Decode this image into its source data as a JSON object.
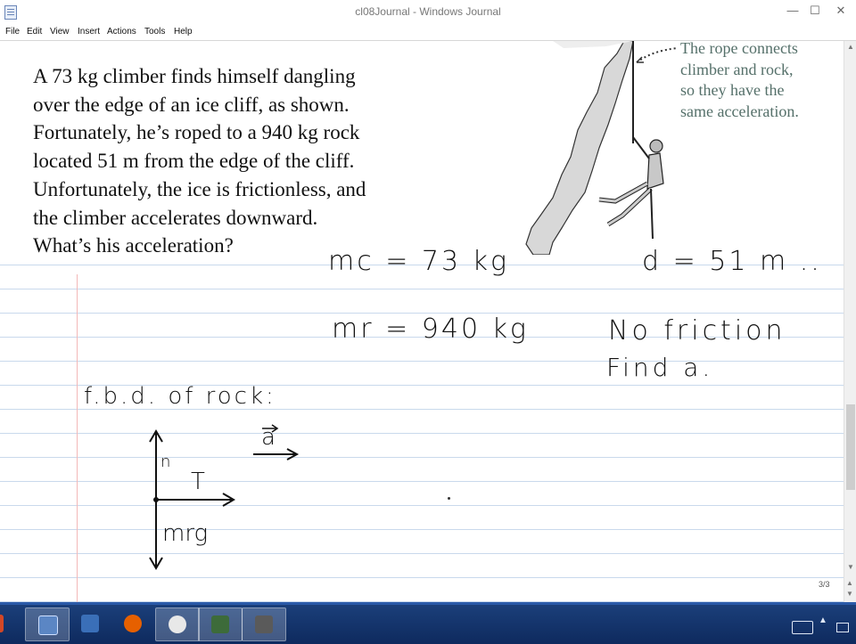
{
  "window": {
    "title": "cl08Journal - Windows Journal",
    "min_glyph": "—",
    "max_glyph": "☐",
    "close_glyph": "✕"
  },
  "menu": {
    "items": [
      "File",
      "Edit",
      "View",
      "Insert",
      "Actions",
      "Tools",
      "Help"
    ]
  },
  "problem": {
    "text": "A 73 kg climber finds himself dangling\nover the edge of an ice cliff, as shown.\nFortunately, he’s roped to a 940 kg rock\nlocated 51 m from the edge of the cliff.\nUnfortunately, the ice is frictionless, and\nthe climber accelerates downward.\nWhat’s his acceleration?",
    "caption": "The rope connects\nclimber and rock,\nso they have the\nsame acceleration."
  },
  "notes": {
    "mc": "mc = 73 kg",
    "mr": "mr = 940 kg",
    "d": "d = 51 m ..",
    "no_friction": "No friction",
    "find": "Find a.",
    "fbd_title": "f.b.d. of rock:",
    "force_n": "n",
    "force_T": "T",
    "force_mrg": "mrg",
    "accel_label": "a"
  },
  "status": {
    "page_indicator": "3/3"
  },
  "icons": {
    "app": "journal-icon",
    "taskbar": [
      "powerpoint-icon",
      "windows-journal-icon",
      "network-icon",
      "firefox-icon",
      "camtasia-icon",
      "media-icon",
      "pen-tool-icon"
    ],
    "tray": [
      "keyboard-icon",
      "action-center-icon",
      "monitor-icon"
    ]
  },
  "colors": {
    "accent_red": "#d7372c",
    "taskbar": "#1b3f7a",
    "rule_lines": "#c9d9ec",
    "margin_line": "#f3b8b8",
    "caption": "#55706a"
  }
}
